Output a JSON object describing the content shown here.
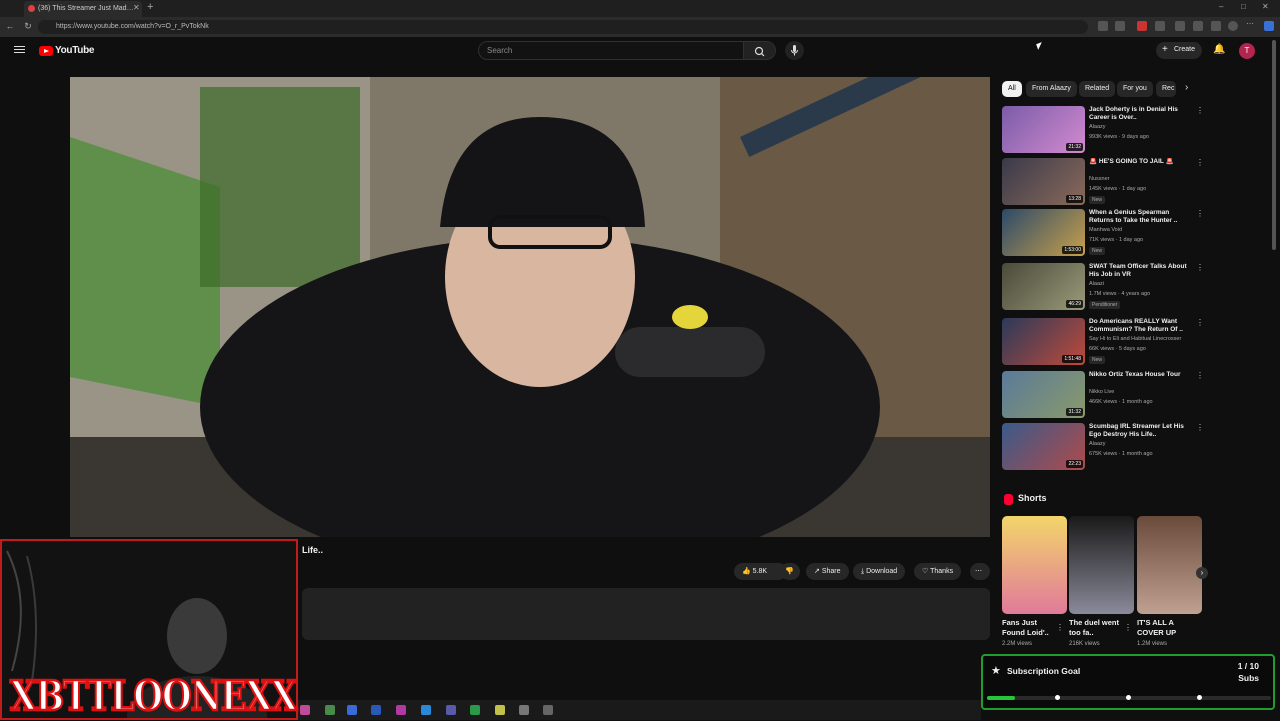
{
  "browser": {
    "tab_title": "(36) This Streamer Just Mad…",
    "url": "https://www.youtube.com/watch?v=O_r_PvTokNk"
  },
  "header": {
    "logo_text": "YouTube",
    "search_placeholder": "Search",
    "create_label": "Create",
    "avatar_letter": "T"
  },
  "video": {
    "title_fragment": "Life.."
  },
  "actions": {
    "like_count": "5.8K",
    "share_label": "Share",
    "download_label": "Download",
    "thanks_label": "Thanks"
  },
  "chips": [
    "All",
    "From Alaazy",
    "Related",
    "For you",
    "Rec"
  ],
  "recommendations": [
    {
      "title": "Jack Doherty is in Denial His Career is Over..",
      "channel": "Alaazy",
      "meta": "993K views · 9 days ago",
      "duration": "21:32",
      "badge": ""
    },
    {
      "title": "🚨 HE'S GOING TO JAIL 🚨",
      "channel": "Nussner",
      "meta": "145K views · 1 day ago",
      "duration": "13:28",
      "badge": "New"
    },
    {
      "title": "When a Genius Spearman Returns to Take the Hunter ..",
      "channel": "Manhwa Void",
      "meta": "71K views · 1 day ago",
      "duration": "1:53:00",
      "badge": "New"
    },
    {
      "title": "SWAT Team Officer Talks About His Job in VR",
      "channel": "Alaazi",
      "meta": "1.7M views · 4 years ago",
      "duration": "46:29",
      "badge": "Penditioner"
    },
    {
      "title": "Do Americans REALLY Want Communism? The Return Of ..",
      "channel": "Say Hi to Eli and Habitual Linecrosser",
      "meta": "66K views · 5 days ago",
      "duration": "1:51:48",
      "badge": "New"
    },
    {
      "title": "Nikko Ortiz Texas House Tour",
      "channel": "Nikko Live",
      "meta": "466K views · 1 month ago",
      "duration": "31:32",
      "badge": ""
    },
    {
      "title": "Scumbag IRL Streamer Let His Ego Destroy His Life..",
      "channel": "Alaazy",
      "meta": "675K views · 1 month ago",
      "duration": "22:23",
      "badge": ""
    }
  ],
  "shorts": {
    "title": "Shorts",
    "items": [
      {
        "title": "Fans Just Found Loid'..",
        "views": "2.2M views"
      },
      {
        "title": "The duel went too fa..",
        "views": "216K views"
      },
      {
        "title": "IT'S ALL A COVER UP",
        "views": "1.2M views"
      }
    ]
  },
  "overlay": {
    "streamer_name": "XBTTLOONEXX",
    "goal_title": "Subscription Goal",
    "goal_count": "1 / 10",
    "goal_units": "Subs",
    "goal_progress": 0.1
  },
  "colors": {
    "yt_red": "#ff0000",
    "goal_green": "#25c73a",
    "webcam_border": "#c31b1b"
  }
}
